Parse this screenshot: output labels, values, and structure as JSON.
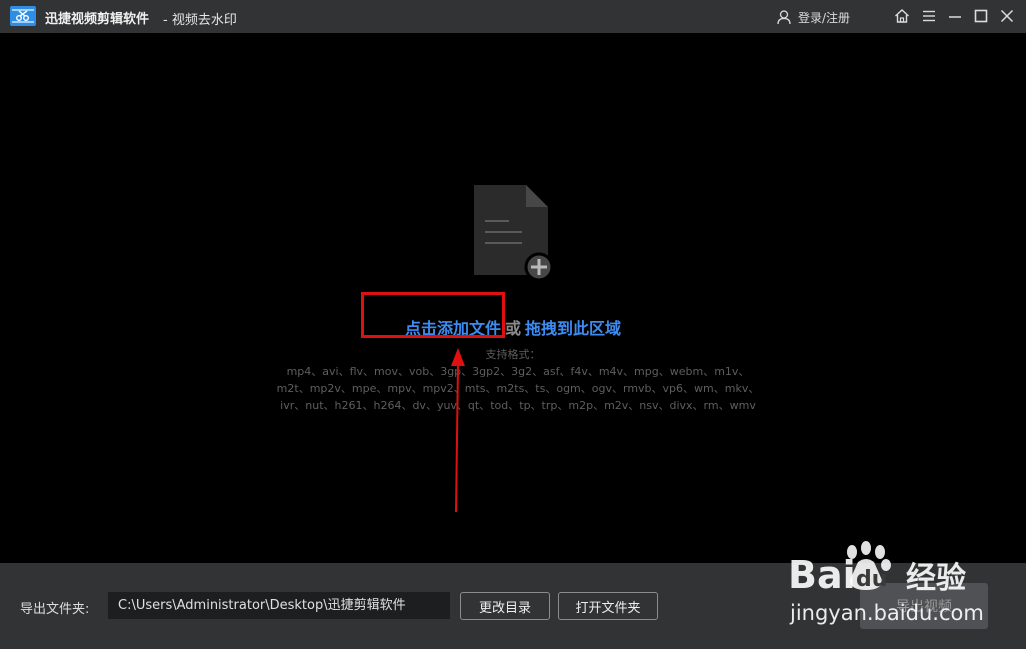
{
  "titlebar": {
    "app_name": "迅捷视频剪辑软件",
    "subtitle": "- 视频去水印",
    "login_label": "登录/注册"
  },
  "main": {
    "add_file_label": "点击添加文件",
    "or_label": "或",
    "drag_label": "拖拽到此区域",
    "formats_title": "支持格式：",
    "formats_lines": [
      "mp4、avi、flv、mov、vob、3gp、3gp2、3g2、asf、f4v、m4v、mpg、webm、m1v、",
      "m2t、mp2v、mpe、mpv、mpv2、mts、m2ts、ts、ogm、ogv、rmvb、vp6、wm、mkv、",
      "ivr、nut、h261、h264、dv、yuv、qt、tod、tp、trp、m2p、m2v、nsv、divx、rm、wmv"
    ]
  },
  "bottom": {
    "output_label": "导出文件夹:",
    "output_path": "C:\\Users\\Administrator\\Desktop\\迅捷剪辑软件",
    "change_dir_label": "更改目录",
    "open_folder_label": "打开文件夹",
    "export_label": "导出视频"
  },
  "watermark": {
    "brand_bai": "Bai",
    "brand_du": "du",
    "brand_cn": "经验",
    "url": "jingyan.baidu.com"
  },
  "colors": {
    "titlebar_bg": "#323335",
    "accent_link": "#3e8cf2",
    "highlight_red": "#e01010",
    "main_bg": "#000000"
  },
  "icons": [
    "app-logo-icon",
    "user-icon",
    "home-icon",
    "menu-icon",
    "minimize-icon",
    "maximize-icon",
    "close-icon",
    "add-file-icon"
  ]
}
